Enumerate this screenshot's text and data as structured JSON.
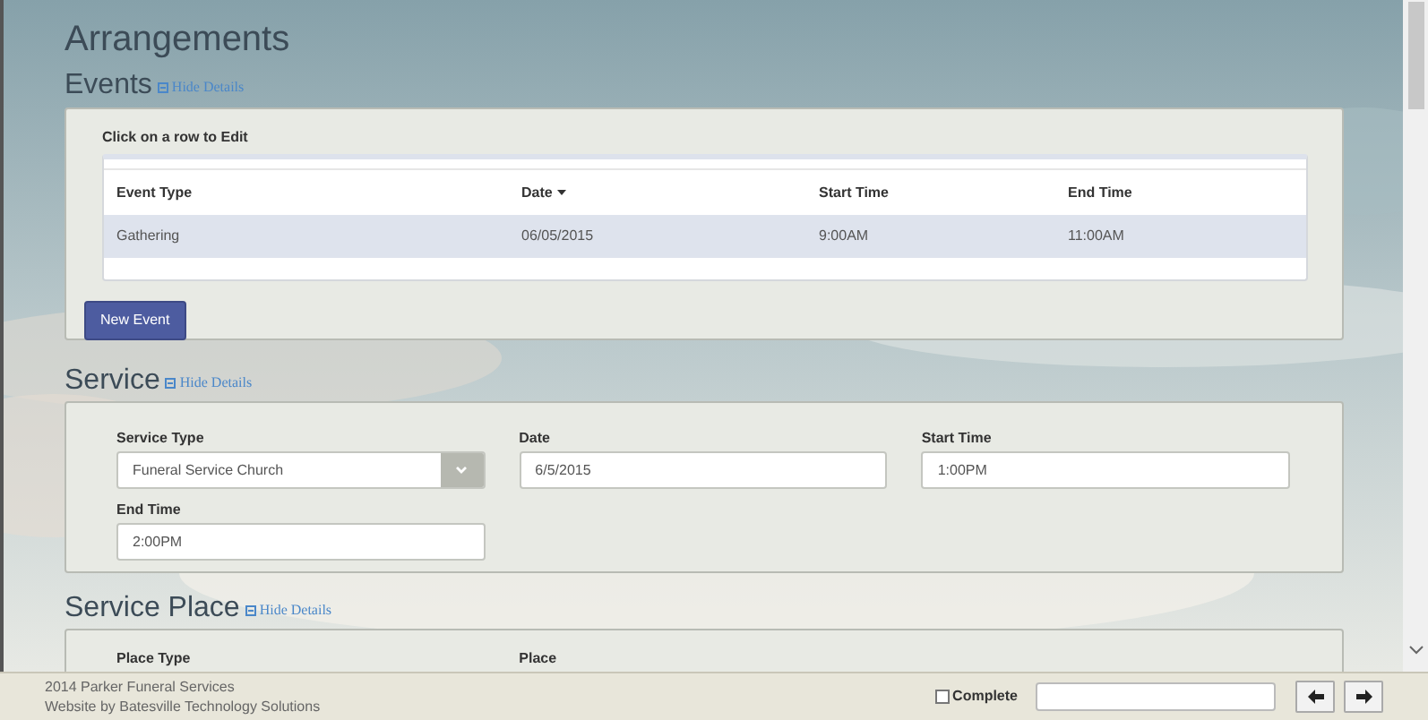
{
  "title": "Arrangements",
  "events": {
    "heading": "Events",
    "toggle": "Hide Details",
    "instruction": "Click on a row to Edit",
    "columns": [
      {
        "label": "Event Type",
        "sorted": false
      },
      {
        "label": "Date",
        "sorted": true
      },
      {
        "label": "Start Time",
        "sorted": false
      },
      {
        "label": "End Time",
        "sorted": false
      }
    ],
    "rows": [
      {
        "cells": [
          "Gathering",
          "06/05/2015",
          "9:00AM",
          "11:00AM"
        ]
      }
    ],
    "button": "New Event"
  },
  "service": {
    "heading": "Service",
    "toggle": "Hide Details",
    "fields": [
      {
        "kind": "select",
        "label": "Service Type",
        "value": "Funeral Service Church"
      },
      {
        "kind": "text",
        "label": "Date",
        "value": "6/5/2015"
      },
      {
        "kind": "text",
        "label": "Start Time",
        "value": "1:00PM"
      },
      {
        "kind": "text",
        "label": "End Time",
        "value": "2:00PM"
      }
    ]
  },
  "service_place": {
    "heading": "Service Place",
    "toggle": "Hide Details",
    "labels": [
      "Place Type",
      "Place"
    ]
  },
  "footer": {
    "lines": [
      "2014 Parker Funeral Services",
      "Website by Batesville Technology Solutions"
    ],
    "complete": {
      "label": "Complete",
      "checked": false
    }
  }
}
